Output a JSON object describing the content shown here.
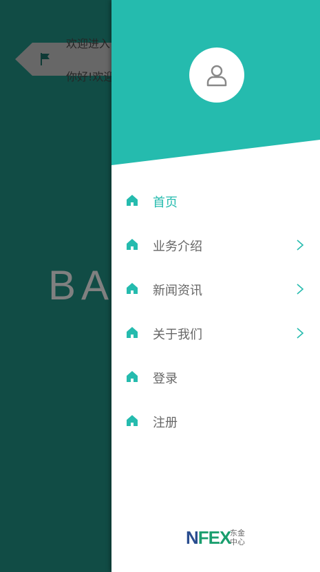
{
  "background": {
    "line1": "欢迎进入",
    "line2": "你好!欢迎",
    "banner": "BA"
  },
  "drawer": {
    "menu": [
      {
        "label": "首页",
        "active": true,
        "has_children": false
      },
      {
        "label": "业务介绍",
        "active": false,
        "has_children": true
      },
      {
        "label": "新闻资讯",
        "active": false,
        "has_children": true
      },
      {
        "label": "关于我们",
        "active": false,
        "has_children": true
      },
      {
        "label": "登录",
        "active": false,
        "has_children": false
      },
      {
        "label": "注册",
        "active": false,
        "has_children": false
      }
    ],
    "logo": {
      "mark_n": "N",
      "mark_fex": "FEX",
      "cn_line1": "东金",
      "cn_line2": "中心"
    }
  },
  "colors": {
    "accent": "#25bbae",
    "background_page": "#1f8a7e",
    "menu_text": "#666666"
  },
  "icons": {
    "avatar": "user-icon",
    "menu": "home-icon",
    "submenu": "chevron-right-icon",
    "background_tag": "flag-icon"
  }
}
